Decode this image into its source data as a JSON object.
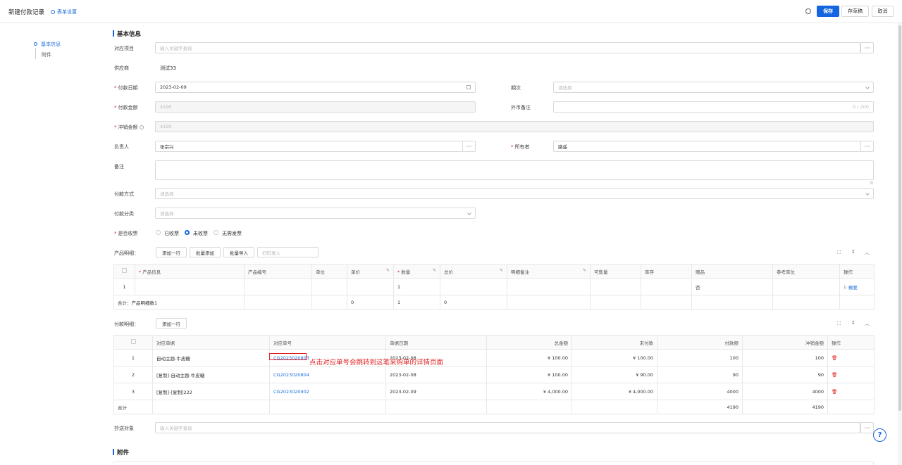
{
  "header": {
    "title": "新建付款记录",
    "form_settings": "表单设置",
    "save": "保存",
    "draft": "存草稿",
    "cancel": "取消"
  },
  "nav": {
    "basic": "基本信息",
    "attachment": "附件"
  },
  "section": {
    "basic": "基本信息",
    "attachment": "附件"
  },
  "form": {
    "project_label": "对应项目",
    "project_placeholder": "输入关键字查询",
    "supplier_label": "供应商",
    "supplier_value": "测试33",
    "pay_date_label": "付款日期",
    "pay_date_value": "2023-02-09",
    "period_label": "期次",
    "period_placeholder": "请选择",
    "pay_amount_label": "付款金额",
    "pay_amount_value": "4190",
    "fx_remark_label": "外币备注",
    "fx_remark_count": "0 / 200",
    "offset_label": "冲销金额",
    "offset_value": "4190",
    "owner_label": "负责人",
    "owner_value": "张宗兴",
    "holder_label": "所有者",
    "holder_value": "路遥",
    "remark_label": "备注",
    "remark_count": "0",
    "pay_method_label": "付款方式",
    "pay_method_placeholder": "请选择",
    "pay_class_label": "付款分类",
    "pay_class_placeholder": "请选择",
    "invoice_label": "是否收票",
    "invoice_opt1": "已收票",
    "invoice_opt2": "未收票",
    "invoice_opt3": "无需发票",
    "cc_label": "抄送对象",
    "cc_placeholder": "输入关键字查询"
  },
  "product": {
    "label": "产品明细：",
    "add_row": "添加一行",
    "batch_add": "批量添加",
    "batch_import": "批量导入",
    "scan_placeholder": "扫码录入",
    "headers": [
      "产品信息",
      "产品编号",
      "单位",
      "单价",
      "数量",
      "总价",
      "明细备注",
      "可售量",
      "库存",
      "赠品",
      "参考库位",
      "操作"
    ],
    "row": {
      "index": "1",
      "qty": "1",
      "gift": "否",
      "op": "概要"
    },
    "total": {
      "label": "合计：产品明细数1",
      "price": "0",
      "qty": "1",
      "sum": "0"
    }
  },
  "payment": {
    "label": "付款明细：",
    "add_row": "添加一行",
    "headers": [
      "对应单据",
      "对应单号",
      "单据日期",
      "总金额",
      "未付款",
      "付款额",
      "冲销金额",
      "操作"
    ],
    "rows": [
      {
        "idx": "1",
        "doc": "自动主题-牛皮糖",
        "no": "CG2023020803",
        "date": "2023-02-08",
        "total": "¥ 100.00",
        "unpaid": "¥ 100.00",
        "paid": "100",
        "offset": "100"
      },
      {
        "idx": "2",
        "doc": "[复制]-自动主题-牛皮糖",
        "no": "CG2023020804",
        "date": "2023-02-08",
        "total": "¥ 100.00",
        "unpaid": "¥ 90.00",
        "paid": "90",
        "offset": "90"
      },
      {
        "idx": "3",
        "doc": "[复制]-[复制]222",
        "no": "CG2023020902",
        "date": "2023-02-09",
        "total": "¥ 4,000.00",
        "unpaid": "¥ 4,000.00",
        "paid": "4000",
        "offset": "4000"
      }
    ],
    "total": {
      "label": "合计",
      "paid": "4190",
      "offset": "4190"
    }
  },
  "annotation": "点击对应单号会跳转到这笔采购单的详情页面"
}
